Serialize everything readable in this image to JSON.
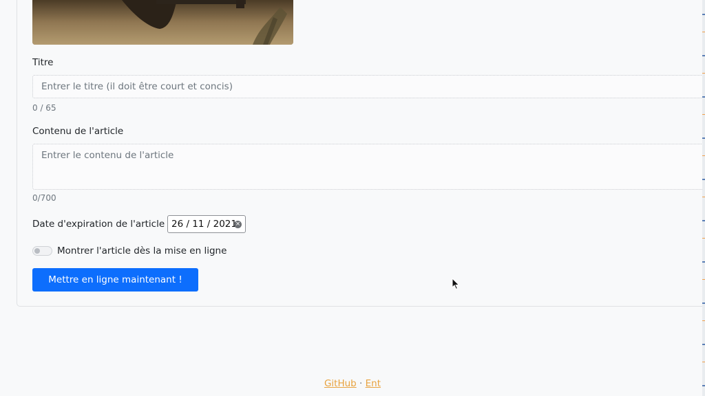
{
  "form": {
    "title_label": "Titre",
    "title_placeholder": "Entrer le titre (il doit être court et concis)",
    "title_counter": "0 / 65",
    "content_label": "Contenu de l'article",
    "content_placeholder": "Entrer le contenu de l'article",
    "content_counter": "0/700",
    "expiry_label": "Date d'expiration de l'article :",
    "expiry_value": "26 / 11 / 2021",
    "show_label": "Montrer l'article dès la mise en ligne",
    "show_enabled": false,
    "submit_label": "Mettre en ligne maintenant !"
  },
  "footer": {
    "github_link": "GitHub",
    "separator": "·",
    "ent_link": "Ent"
  },
  "icons": {
    "clear": "clear-date-icon",
    "cursor": "mouse-cursor-icon",
    "toggle": "toggle-switch"
  }
}
